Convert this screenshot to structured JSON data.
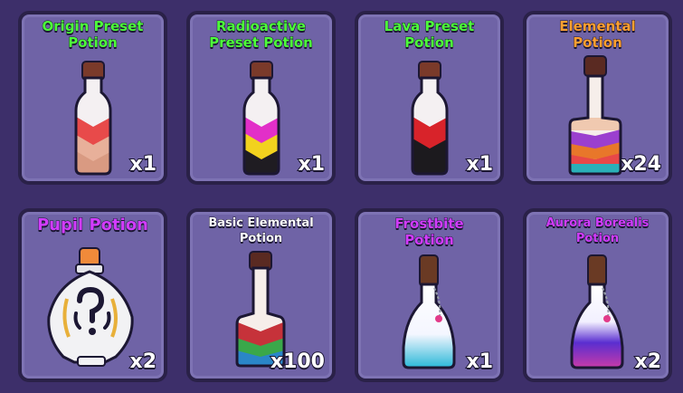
{
  "inventory": {
    "slots": [
      {
        "name": "Origin Preset\nPotion",
        "count": "x1",
        "name_color": "#4dff3a",
        "icon": "origin-preset-potion-icon"
      },
      {
        "name": "Radioactive\nPreset Potion",
        "count": "x1",
        "name_color": "#4dff3a",
        "icon": "radioactive-preset-potion-icon"
      },
      {
        "name": "Lava Preset\nPotion",
        "count": "x1",
        "name_color": "#4dff3a",
        "icon": "lava-preset-potion-icon"
      },
      {
        "name": "Elemental\nPotion",
        "count": "x24",
        "name_color": "#ffa030",
        "icon": "elemental-potion-icon"
      },
      {
        "name": "Pupil Potion",
        "count": "x2",
        "name_color": "#d23cff",
        "icon": "pupil-potion-icon"
      },
      {
        "name": "Basic Elemental\nPotion",
        "count": "x100",
        "name_color": "#ffffff",
        "icon": "basic-elemental-potion-icon"
      },
      {
        "name": "Frostbite\nPotion",
        "count": "x1",
        "name_color": "#d23cff",
        "icon": "frostbite-potion-icon"
      },
      {
        "name": "Aurora Borealis\nPotion",
        "count": "x2",
        "name_color": "#d23cff",
        "icon": "aurora-borealis-potion-icon"
      }
    ]
  }
}
